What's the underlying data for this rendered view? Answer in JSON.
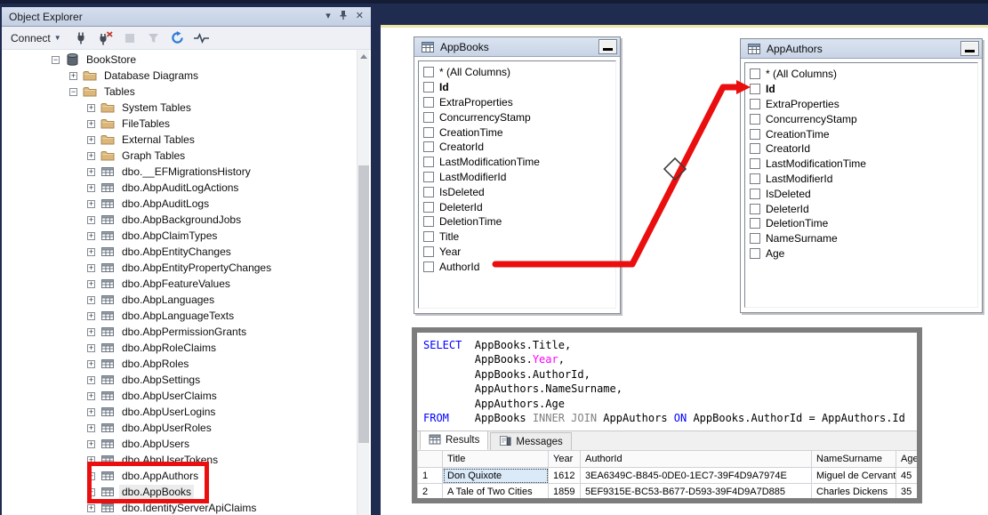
{
  "colors": {
    "shell_navy": "#1f2c4f",
    "accent_yellow": "#ece4a4",
    "annotation_red": "#ea0e0e",
    "annotation_gray": "#7d7d7d",
    "keyword_blue": "#0000ff",
    "year_magenta": "#ff00ff",
    "join_gray": "#808080"
  },
  "object_explorer": {
    "title": "Object Explorer",
    "titlebar_icons": [
      "window-position-chevron",
      "pin",
      "close"
    ],
    "toolbar": {
      "connect_label": "Connect",
      "icons": [
        "connect",
        "disconnect",
        "stop",
        "filter",
        "refresh",
        "activity-monitor"
      ]
    },
    "tree": [
      {
        "label": "BookStore",
        "level": 1,
        "expand": "minus",
        "icon": "database"
      },
      {
        "label": "Database Diagrams",
        "level": 2,
        "expand": "plus",
        "icon": "folder"
      },
      {
        "label": "Tables",
        "level": 2,
        "expand": "minus",
        "icon": "folder"
      },
      {
        "label": "System Tables",
        "level": 3,
        "expand": "plus",
        "icon": "folder"
      },
      {
        "label": "FileTables",
        "level": 3,
        "expand": "plus",
        "icon": "folder"
      },
      {
        "label": "External Tables",
        "level": 3,
        "expand": "plus",
        "icon": "folder"
      },
      {
        "label": "Graph Tables",
        "level": 3,
        "expand": "plus",
        "icon": "folder"
      },
      {
        "label": "dbo.__EFMigrationsHistory",
        "level": 3,
        "expand": "plus",
        "icon": "table"
      },
      {
        "label": "dbo.AbpAuditLogActions",
        "level": 3,
        "expand": "plus",
        "icon": "table"
      },
      {
        "label": "dbo.AbpAuditLogs",
        "level": 3,
        "expand": "plus",
        "icon": "table"
      },
      {
        "label": "dbo.AbpBackgroundJobs",
        "level": 3,
        "expand": "plus",
        "icon": "table"
      },
      {
        "label": "dbo.AbpClaimTypes",
        "level": 3,
        "expand": "plus",
        "icon": "table"
      },
      {
        "label": "dbo.AbpEntityChanges",
        "level": 3,
        "expand": "plus",
        "icon": "table"
      },
      {
        "label": "dbo.AbpEntityPropertyChanges",
        "level": 3,
        "expand": "plus",
        "icon": "table"
      },
      {
        "label": "dbo.AbpFeatureValues",
        "level": 3,
        "expand": "plus",
        "icon": "table"
      },
      {
        "label": "dbo.AbpLanguages",
        "level": 3,
        "expand": "plus",
        "icon": "table"
      },
      {
        "label": "dbo.AbpLanguageTexts",
        "level": 3,
        "expand": "plus",
        "icon": "table"
      },
      {
        "label": "dbo.AbpPermissionGrants",
        "level": 3,
        "expand": "plus",
        "icon": "table"
      },
      {
        "label": "dbo.AbpRoleClaims",
        "level": 3,
        "expand": "plus",
        "icon": "table"
      },
      {
        "label": "dbo.AbpRoles",
        "level": 3,
        "expand": "plus",
        "icon": "table"
      },
      {
        "label": "dbo.AbpSettings",
        "level": 3,
        "expand": "plus",
        "icon": "table"
      },
      {
        "label": "dbo.AbpUserClaims",
        "level": 3,
        "expand": "plus",
        "icon": "table"
      },
      {
        "label": "dbo.AbpUserLogins",
        "level": 3,
        "expand": "plus",
        "icon": "table"
      },
      {
        "label": "dbo.AbpUserRoles",
        "level": 3,
        "expand": "plus",
        "icon": "table"
      },
      {
        "label": "dbo.AbpUsers",
        "level": 3,
        "expand": "plus",
        "icon": "table"
      },
      {
        "label": "dbo.AbpUserTokens",
        "level": 3,
        "expand": "plus",
        "icon": "table"
      },
      {
        "label": "dbo.AppAuthors",
        "level": 3,
        "expand": "plus",
        "icon": "table"
      },
      {
        "label": "dbo.AppBooks",
        "level": 3,
        "expand": "plus",
        "icon": "table",
        "selected": true
      },
      {
        "label": "dbo.IdentityServerApiClaims",
        "level": 3,
        "expand": "plus",
        "icon": "table"
      }
    ]
  },
  "designer": {
    "tables": [
      {
        "name": "AppBooks",
        "columns": [
          {
            "label": "* (All Columns)"
          },
          {
            "label": "Id",
            "bold": true
          },
          {
            "label": "ExtraProperties"
          },
          {
            "label": "ConcurrencyStamp"
          },
          {
            "label": "CreationTime"
          },
          {
            "label": "CreatorId"
          },
          {
            "label": "LastModificationTime"
          },
          {
            "label": "LastModifierId"
          },
          {
            "label": "IsDeleted"
          },
          {
            "label": "DeleterId"
          },
          {
            "label": "DeletionTime"
          },
          {
            "label": "Title"
          },
          {
            "label": "Year"
          },
          {
            "label": "AuthorId"
          }
        ]
      },
      {
        "name": "AppAuthors",
        "columns": [
          {
            "label": "* (All Columns)"
          },
          {
            "label": "Id",
            "bold": true
          },
          {
            "label": "ExtraProperties"
          },
          {
            "label": "ConcurrencyStamp"
          },
          {
            "label": "CreationTime"
          },
          {
            "label": "CreatorId"
          },
          {
            "label": "LastModificationTime"
          },
          {
            "label": "LastModifierId"
          },
          {
            "label": "IsDeleted"
          },
          {
            "label": "DeleterId"
          },
          {
            "label": "DeletionTime"
          },
          {
            "label": "NameSurname"
          },
          {
            "label": "Age"
          }
        ]
      }
    ]
  },
  "sql": {
    "lines": [
      [
        {
          "text": "SELECT",
          "color": "kw"
        },
        {
          "text": "  AppBooks.Title,",
          "color": "plain"
        }
      ],
      [
        {
          "text": "        AppBooks.",
          "color": "plain"
        },
        {
          "text": "Year",
          "color": "magenta"
        },
        {
          "text": ",",
          "color": "plain"
        }
      ],
      [
        {
          "text": "        AppBooks.AuthorId,",
          "color": "plain"
        }
      ],
      [
        {
          "text": "        AppAuthors.NameSurname,",
          "color": "plain"
        }
      ],
      [
        {
          "text": "        AppAuthors.Age",
          "color": "plain"
        }
      ],
      [
        {
          "text": "FROM",
          "color": "kw"
        },
        {
          "text": "    AppBooks ",
          "color": "plain"
        },
        {
          "text": "INNER JOIN",
          "color": "gray"
        },
        {
          "text": " AppAuthors ",
          "color": "plain"
        },
        {
          "text": "ON",
          "color": "kw"
        },
        {
          "text": " AppBooks.AuthorId = AppAuthors.Id",
          "color": "plain"
        }
      ]
    ]
  },
  "results": {
    "tabs": [
      {
        "label": "Results",
        "icon": "results-grid",
        "selected": true
      },
      {
        "label": "Messages",
        "icon": "messages",
        "selected": false
      }
    ],
    "grid": {
      "headers": [
        "",
        "Title",
        "Year",
        "AuthorId",
        "NameSurname",
        "Age"
      ],
      "rows": [
        {
          "num": "1",
          "cells": [
            "Don Quixote",
            "1612",
            "3EA6349C-B845-0DE0-1EC7-39F4D9A7974E",
            "Miguel de Cervantes",
            "45"
          ]
        },
        {
          "num": "2",
          "cells": [
            "A Tale of Two Cities",
            "1859",
            "5EF9315E-BC53-B677-D593-39F4D9A7D885",
            "Charles Dickens",
            "35"
          ]
        }
      ],
      "focused_row": 0,
      "focused_col": 0
    }
  }
}
